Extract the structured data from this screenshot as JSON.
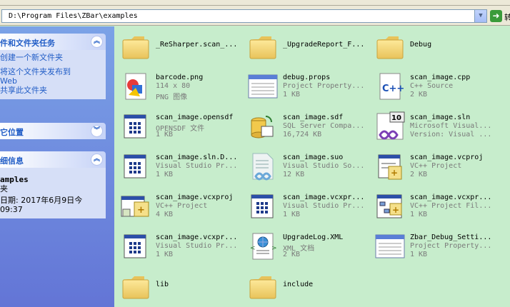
{
  "address": {
    "path": "D:\\Program Files\\ZBar\\examples",
    "go_label": "转"
  },
  "sidebar": {
    "tasks": {
      "title": "件和文件夹任务",
      "items": [
        "创建一个新文件夹",
        "将这个文件夹发布到",
        "Web",
        "共享此文件夹"
      ]
    },
    "places": {
      "title": "它位置"
    },
    "details": {
      "title": "细信息",
      "name": "amples",
      "type": "夹",
      "modified_label": "日期: 2017年6月9日今",
      "modified_time": "09:37"
    }
  },
  "files": [
    {
      "name": "_ReSharper.scan_...",
      "line1": "",
      "line2": "",
      "icon": "folder-icon"
    },
    {
      "name": "_UpgradeReport_F...",
      "line1": "",
      "line2": "",
      "icon": "folder-icon"
    },
    {
      "name": "Debug",
      "line1": "",
      "line2": "",
      "icon": "folder-icon"
    },
    {
      "name": "barcode.png",
      "line1": "114 x 80",
      "line2": "PNG 图像",
      "icon": "png-image-icon"
    },
    {
      "name": "debug.props",
      "line1": "Project Property...",
      "line2": "1 KB",
      "icon": "property-sheet-icon"
    },
    {
      "name": "scan_image.cpp",
      "line1": "C++ Source",
      "line2": "2 KB",
      "icon": "cpp-source-icon"
    },
    {
      "name": "scan_image.opensdf",
      "line1": "OPENSDF 文件",
      "line2": "1 KB",
      "icon": "generic-file-icon"
    },
    {
      "name": "scan_image.sdf",
      "line1": "SQL Server Compa...",
      "line2": "16,724 KB",
      "icon": "sql-database-icon"
    },
    {
      "name": "scan_image.sln",
      "line1": "Microsoft Visual...",
      "line2": "Version: Visual ...",
      "icon": "visual-studio-solution-icon"
    },
    {
      "name": "scan_image.sln.D...",
      "line1": "Visual Studio Pr...",
      "line2": "1 KB",
      "icon": "generic-file-icon"
    },
    {
      "name": "scan_image.suo",
      "line1": "Visual Studio So...",
      "line2": "12 KB",
      "icon": "vs-solution-options-icon"
    },
    {
      "name": "scan_image.vcproj",
      "line1": "VC++ Project",
      "line2": "2 KB",
      "icon": "vc-project-icon"
    },
    {
      "name": "scan_image.vcxproj",
      "line1": "VC++ Project",
      "line2": "4 KB",
      "icon": "vcx-project-icon"
    },
    {
      "name": "scan_image.vcxpr...",
      "line1": "Visual Studio Pr...",
      "line2": "1 KB",
      "icon": "generic-file-icon"
    },
    {
      "name": "scan_image.vcxpr...",
      "line1": "VC++ Project Fil...",
      "line2": "1 KB",
      "icon": "vc-project-filters-icon"
    },
    {
      "name": "scan_image.vcxpr...",
      "line1": "Visual Studio Pr...",
      "line2": "1 KB",
      "icon": "generic-file-icon"
    },
    {
      "name": "UpgradeLog.XML",
      "line1": "XML 文档",
      "line2": "2 KB",
      "icon": "xml-document-icon"
    },
    {
      "name": "Zbar_Debug_Setti...",
      "line1": "Project Property...",
      "line2": "1 KB",
      "icon": "property-sheet-icon"
    },
    {
      "name": "lib",
      "line1": "",
      "line2": "",
      "icon": "folder-icon"
    },
    {
      "name": "include",
      "line1": "",
      "line2": "",
      "icon": "folder-icon"
    }
  ]
}
